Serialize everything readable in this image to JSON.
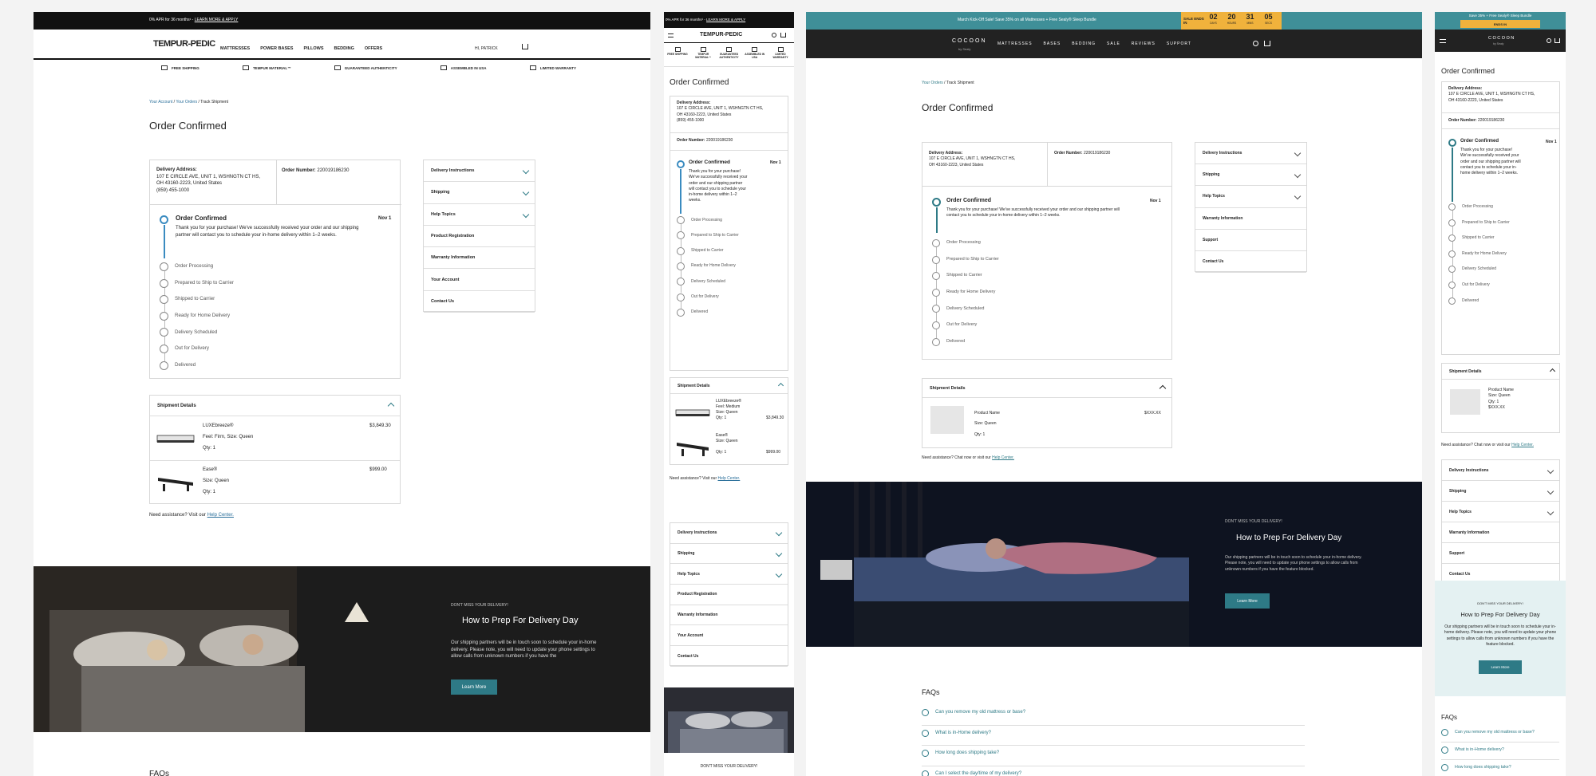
{
  "common": {
    "order_title": "Order Confirmed",
    "address_label": "Delivery Address:",
    "address_line1": "107 E CIRCLE AVE, UNIT 1, WSHNGTN CT HS,",
    "address_line2": "OH 43160-2223, United States",
    "phone": "(859) 455-1000",
    "order_number_label": "Order Number:",
    "order_number": "220019186230",
    "step_title": "Order Confirmed",
    "step_date": "Nov 1",
    "step_desc": "Thank you for your purchase! We've successfully received your order and our shipping partner will contact you to schedule your in-home delivery within 1–2 weeks.",
    "steps": [
      "Order Processing",
      "Prepared to Ship to Carrier",
      "Shipped to Carrier",
      "Ready for Home Delivery",
      "Delivery Scheduled",
      "Out for Delivery",
      "Delivered"
    ],
    "shipment_title": "Shipment Details",
    "assist_text": "Need assistance? Visit our",
    "assist_text_chat": "Need assistance? Chat now or visit our",
    "help_center": "Help Center.",
    "sidebar": [
      "Delivery Instructions",
      "Shipping",
      "Help Topics",
      "Product Registration",
      "Warranty Information",
      "Your Account",
      "Contact Us"
    ],
    "sidebar_cocoon": [
      "Delivery Instructions",
      "Shipping",
      "Help Topics",
      "Warranty Information",
      "Support",
      "Contact Us"
    ],
    "hero_eyebrow": "DON'T MISS YOUR DELIVERY!",
    "hero_title": "How to Prep For Delivery Day",
    "hero_body": "Our shipping partners will be in touch soon to schedule your in-home delivery. Please note, you will need to update your phone settings to allow calls from unknown numbers if you have the feature blocked.",
    "hero_body_short": "Our shipping partners will be in touch soon to schedule your in-home delivery. Please note, you will need to update your phone settings to allow calls from unknown numbers if you have the",
    "hero_button": "Learn More",
    "faqs_title": "FAQs",
    "faqs": [
      "Can you remove my old mattress or base?",
      "What is in-Home delivery?",
      "How long does shipping take?",
      "Can I select the day/time of my delivery?"
    ]
  },
  "tempur": {
    "promo": "0% APR for 36 months¹ - ",
    "promo_link": "LEARN MORE & APPLY",
    "logo": "TEMPUR-PEDIC",
    "nav": [
      "MATTRESSES",
      "POWER BASES",
      "PILLOWS",
      "BEDDING",
      "OFFERS"
    ],
    "user": "HI, PATRICK",
    "cart_count": "0",
    "benefits": [
      "FREE SHIPPING",
      "TEMPUR MATERIAL™",
      "GUARANTEED AUTHENTICITY",
      "ASSEMBLED IN USA",
      "LIMITED WARRANTY"
    ],
    "benefits_mobile": [
      "FREE SHIPPING",
      "TEMPUR MATERIAL™",
      "GUARANTEED AUTHENTICITY",
      "ASSEMBLED IN USA",
      "LIMITED WARRANTY"
    ],
    "breadcrumb": [
      "Your Account",
      "Your Orders",
      "Track Shipment"
    ],
    "products": [
      {
        "name": "LUXEbreeze®",
        "feel": "Feel: Firm, Size: Queen",
        "qty": "Qty: 1",
        "price": "$3,849.30"
      },
      {
        "name": "Ease®",
        "feel": "Size: Queen",
        "qty": "Qty: 1",
        "price": "$999.00"
      }
    ],
    "products_mobile": [
      {
        "name": "LUXEbreeze®",
        "l2": "Feel: Medium",
        "l3": "Size: Queen",
        "qty": "Qty: 1",
        "price": "$3,849.30"
      },
      {
        "name": "Ease®",
        "l2": "Size: Queen",
        "l3": "",
        "qty": "Qty: 1",
        "price": "$999.00"
      }
    ],
    "faq_peek": "FAQs"
  },
  "cocoon": {
    "promo": "March Kick-Off Sale! Save 35% on all Mattresses + Free Sealy® Sleep Bundle",
    "promo_mobile_1": "Save 35% + Free Sealy® Sleep Bundle",
    "sale_label": "SALE ENDS IN",
    "sale_label_mobile": "ENDS IN",
    "timer": [
      {
        "v": "02",
        "u": "DAYS"
      },
      {
        "v": "20",
        "u": "HOURS"
      },
      {
        "v": "31",
        "u": "MINS"
      },
      {
        "v": "05",
        "u": "SECS"
      }
    ],
    "logo": "COCOON",
    "logo_sub": "by Sealy",
    "nav": [
      "MATTRESSES",
      "BASES",
      "BEDDING",
      "SALE",
      "REVIEWS",
      "SUPPORT"
    ],
    "breadcrumb": [
      "Your Orders",
      "Track Shipment"
    ],
    "product": {
      "name": "Product Name",
      "size": "Size: Queen",
      "qty": "Qty: 1",
      "price": "$XXX.XX"
    }
  },
  "colors": {
    "teal": "#2e7a86",
    "blue": "#3a8bc0",
    "timer": "#f0b23c"
  }
}
